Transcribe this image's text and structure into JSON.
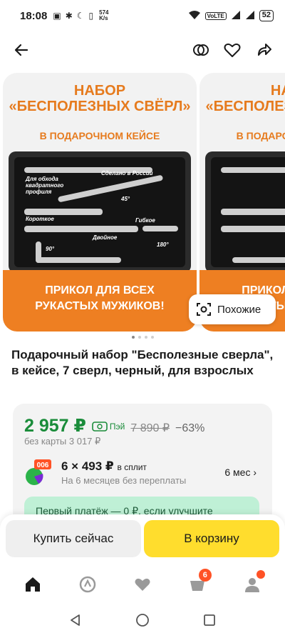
{
  "status_bar": {
    "time": "18:08",
    "net_speed_value": "574",
    "net_speed_unit": "K/s",
    "volte": "VoLTE",
    "battery": "52"
  },
  "gallery": {
    "slide_title_line1": "НАБОР",
    "slide_title_line2": "«БЕСПОЛЕЗНЫХ СВЁРЛ»",
    "slide_subtitle": "В ПОДАРОЧНОМ КЕЙСЕ",
    "case_labels": [
      "Сделано в России",
      "Для обхода квадратного профиля",
      "45°",
      "Короткое",
      "Двойное",
      "Гибкое",
      "90°",
      "180°"
    ],
    "banner_line1": "ПРИКОЛ ДЛЯ ВСЕХ",
    "banner_line2": "РУКАСТЫХ МУЖИКОВ!",
    "similar_label": "Похожие",
    "dot_count": 4,
    "active_dot": 0
  },
  "product": {
    "title": "Подарочный набор \"Бесполезные сверла\", в кейсе, 7 сверл, черный, для взрослых"
  },
  "price": {
    "current": "2 957 ₽",
    "pay_label": "Пэй",
    "old": "7 890 ₽",
    "discount": "−63%",
    "no_card": "без карты 3 017 ₽"
  },
  "split": {
    "badge": "006",
    "amount": "6 × 493 ₽",
    "suffix": "в сплит",
    "subtitle": "На 6 месяцев без переплаты",
    "months": "6 мес ›"
  },
  "first_payment": {
    "text": "Первый платёж — 0 ₽, если улучшите"
  },
  "actions": {
    "buy_now": "Купить сейчас",
    "to_cart": "В корзину"
  },
  "tabs": {
    "cart_badge": "6"
  },
  "colors": {
    "price_green": "#1a8c3a",
    "cart_yellow": "#ffdd2d",
    "promo_orange": "#ee7f22",
    "badge_red": "#ff5226"
  }
}
